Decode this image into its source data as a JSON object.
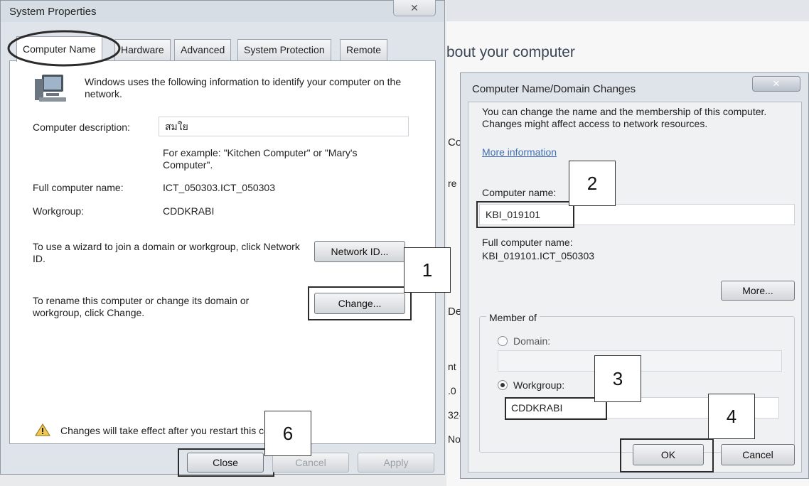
{
  "system_properties": {
    "title": "System Properties",
    "close_glyph": "✕",
    "tabs": [
      {
        "label": "Computer Name"
      },
      {
        "label": "Hardware"
      },
      {
        "label": "Advanced"
      },
      {
        "label": "System Protection"
      },
      {
        "label": "Remote"
      }
    ],
    "intro": "Windows uses the following information to identify your computer on the network.",
    "description_label": "Computer description:",
    "description_value": "สมใย",
    "description_example": "For example: \"Kitchen Computer\" or \"Mary's Computer\".",
    "full_name_label": "Full computer name:",
    "full_name_value": "ICT_050303.ICT_050303",
    "workgroup_label": "Workgroup:",
    "workgroup_value": "CDDKRABI",
    "wizard_text": "To use a wizard to join a domain or workgroup, click Network ID.",
    "network_id_button": "Network ID...",
    "rename_text": "To rename this computer or change its domain or workgroup, click Change.",
    "change_button": "Change...",
    "restart_note": "Changes will take effect after you restart this computer.",
    "close_button": "Close",
    "cancel_button": "Cancel",
    "apply_button": "Apply"
  },
  "background_window": {
    "heading": "bout your computer",
    "fragments": [
      "Co",
      "re",
      "De",
      "nt",
      ".0",
      "32-",
      "No"
    ]
  },
  "name_changes": {
    "title": "Computer Name/Domain Changes",
    "close_glyph": "✕",
    "info": "You can change the name and the membership of this computer. Changes might affect access to network resources.",
    "more_info_link": "More information",
    "computer_name_label": "Computer name:",
    "computer_name_value": "KBI_019101",
    "full_name_label": "Full computer name:",
    "full_name_value": "KBI_019101.ICT_050303",
    "more_button": "More...",
    "member_of_label": "Member of",
    "domain_label": "Domain:",
    "domain_value": "",
    "workgroup_label": "Workgroup:",
    "workgroup_value": "CDDKRABI",
    "ok_button": "OK",
    "cancel_button": "Cancel",
    "selected_membership": "workgroup"
  },
  "step_markers": [
    "1",
    "2",
    "3",
    "4",
    "6"
  ]
}
